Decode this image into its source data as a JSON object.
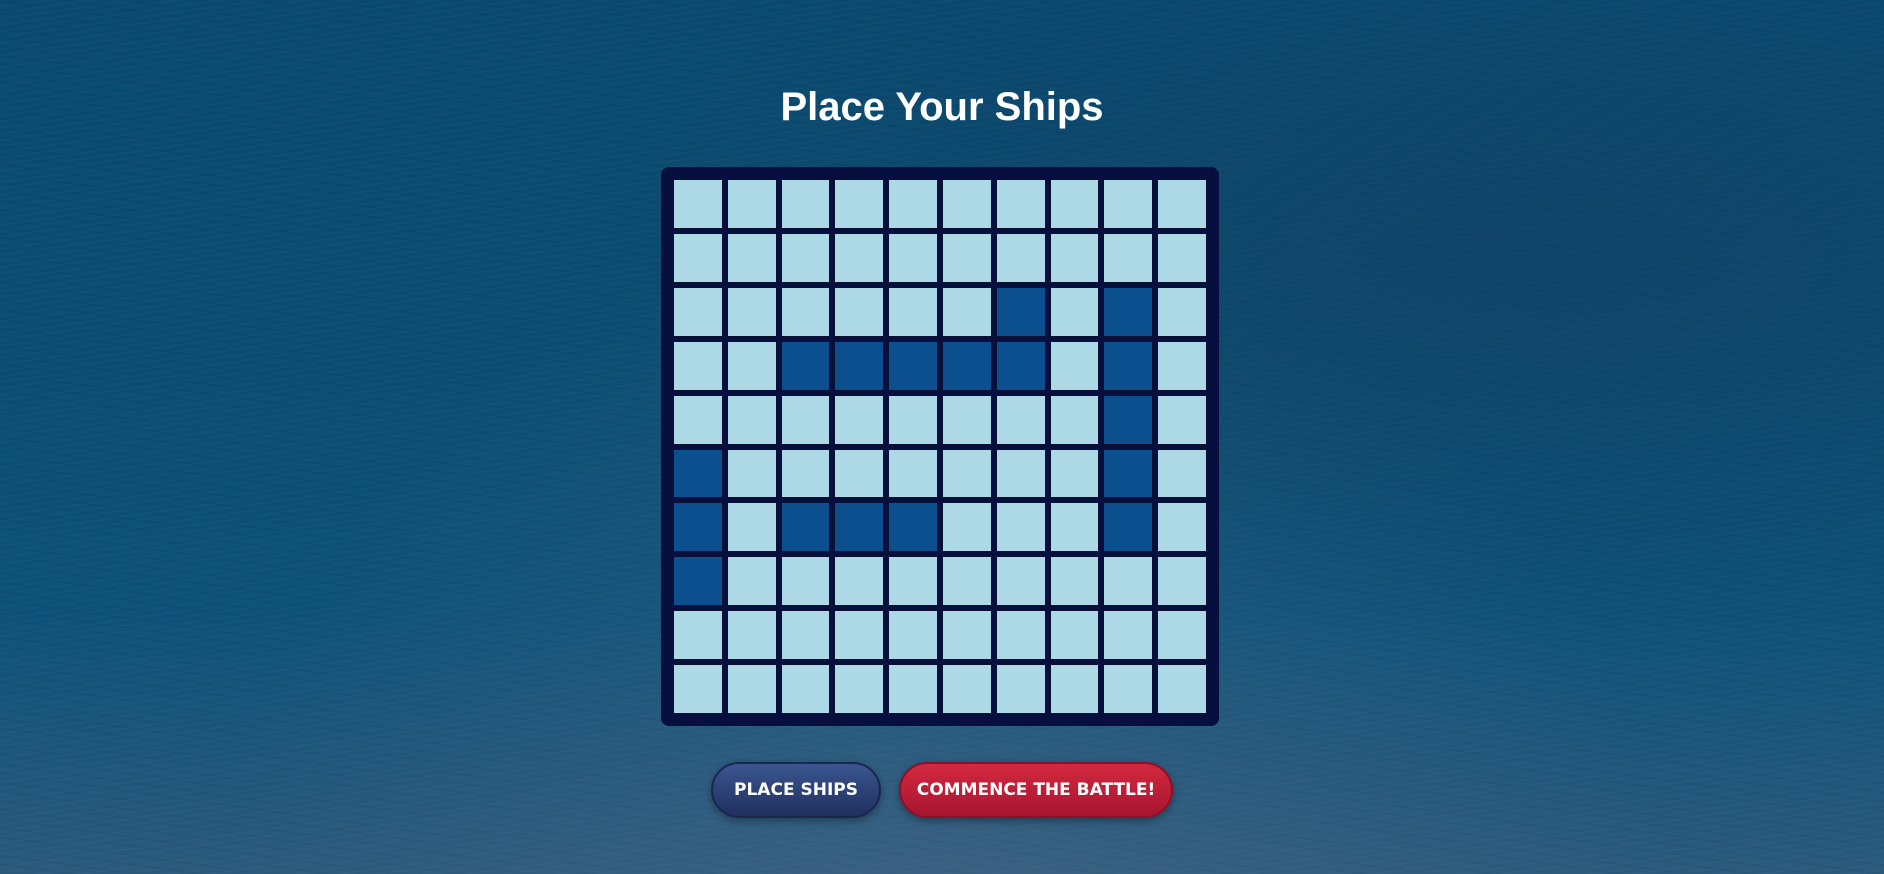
{
  "page": {
    "title": "Place Your Ships"
  },
  "board": {
    "rows": 10,
    "cols": 10,
    "ship_cells": [
      [
        2,
        6
      ],
      [
        2,
        8
      ],
      [
        3,
        2
      ],
      [
        3,
        3
      ],
      [
        3,
        4
      ],
      [
        3,
        5
      ],
      [
        3,
        6
      ],
      [
        3,
        8
      ],
      [
        4,
        8
      ],
      [
        5,
        0
      ],
      [
        5,
        8
      ],
      [
        6,
        0
      ],
      [
        6,
        2
      ],
      [
        6,
        3
      ],
      [
        6,
        4
      ],
      [
        6,
        8
      ],
      [
        7,
        0
      ]
    ]
  },
  "buttons": {
    "place_label": "PLACE SHIPS",
    "battle_label": "COMMENCE THE BATTLE!"
  },
  "colors": {
    "water_cell": "#add8e6",
    "ship_cell": "#0b4f8e",
    "board_frame": "#070f3f",
    "place_button": "#2a3f75",
    "battle_button": "#c21f38"
  }
}
